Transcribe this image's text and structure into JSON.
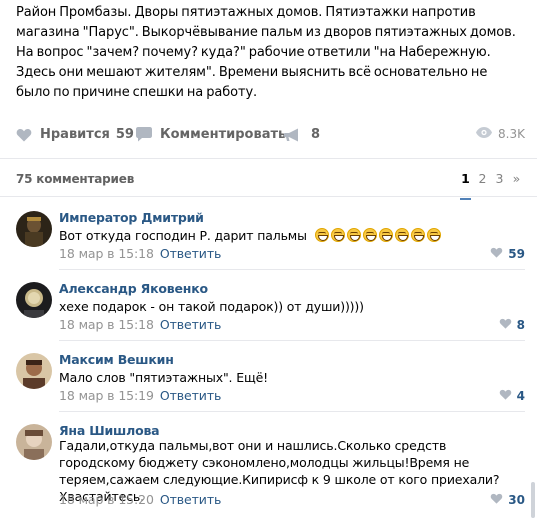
{
  "post": {
    "text": "Район Промбазы. Дворы пятиэтажных домов. Пятиэтажки напротив магазина \"Парус\". Выкорчёвывание пальм из дворов пятиэтажных домов. На вопрос \"зачем? почему? куда?\" рабочие ответили \"на Набережную. Здесь они мешают жителям\". Времени выяснить всё основательно не было по причине спешки на работу."
  },
  "actions": {
    "like_label": "Нравится",
    "like_count": "59",
    "comment_label": "Комментировать",
    "share_count": "8",
    "views": "8.3K"
  },
  "comments_header": {
    "count_label": "75 комментариев",
    "pages": [
      "1",
      "2",
      "3"
    ],
    "next": "»"
  },
  "comments": [
    {
      "author": "Император Дмитрий",
      "text": "Вот откуда господин Р. дарит пальмы",
      "emoji_count": 8,
      "date": "18 мар в 15:18",
      "reply": "Ответить",
      "likes": "59"
    },
    {
      "author": "Александр Яковенко",
      "text": "хехе подарок - он такой подарок)) от души)))))",
      "date": "18 мар в 15:18",
      "reply": "Ответить",
      "likes": "8"
    },
    {
      "author": "Максим Вешкин",
      "text": "Мало слов \"пятиэтажных\". Ещё!",
      "date": "18 мар в 15:19",
      "reply": "Ответить",
      "likes": "4"
    },
    {
      "author": "Яна Шишлова",
      "text": "Гадали,откуда пальмы,вот они и нашлись.Сколько средств городскому бюджету сэкономлено,молодцы жильцы!Время не теряем,сажаем следующие.Кипирисф к 9 школе от кого приехали?Хвастайтесь.",
      "date": "18 мар в 15:20",
      "reply": "Ответить",
      "likes": "30"
    }
  ],
  "colors": {
    "link": "#2a5885",
    "muted": "#939393",
    "divider": "#e7e8ec",
    "accent": "#5181b8"
  },
  "icons": {
    "like": "heart-icon",
    "comment": "comment-bubble-icon",
    "share": "megaphone-icon",
    "views": "eye-icon",
    "comment_like": "heart-icon"
  }
}
